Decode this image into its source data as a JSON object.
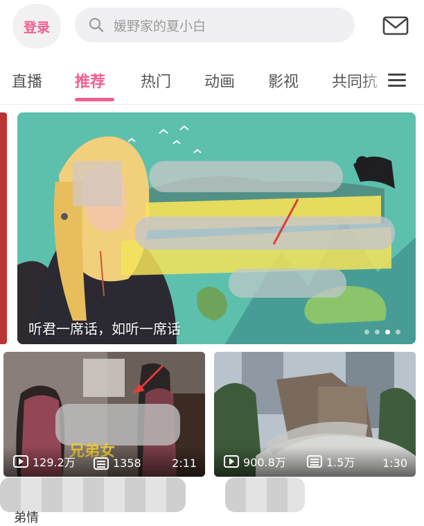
{
  "header": {
    "login_label": "登录",
    "search_placeholder": "媛野家的夏小白"
  },
  "tabs": [
    {
      "label": "直播",
      "active": false
    },
    {
      "label": "推荐",
      "active": true
    },
    {
      "label": "热门",
      "active": false
    },
    {
      "label": "动画",
      "active": false
    },
    {
      "label": "影视",
      "active": false
    },
    {
      "label": "共同抗",
      "active": false
    }
  ],
  "banner": {
    "caption": "听君一席话，如听一席话",
    "page_count": 4,
    "current_page": 3
  },
  "cards": [
    {
      "views": "129.2万",
      "danmaku": "1358",
      "duration": "2:11",
      "overlay_text": "兄弟女"
    },
    {
      "views": "900.8万",
      "danmaku": "1.5万",
      "duration": "1:30"
    }
  ],
  "feed": {
    "next_title_fragment": "弟情"
  },
  "colors": {
    "accent": "#f25d8e",
    "banner_bg": "#5cc0ad"
  }
}
